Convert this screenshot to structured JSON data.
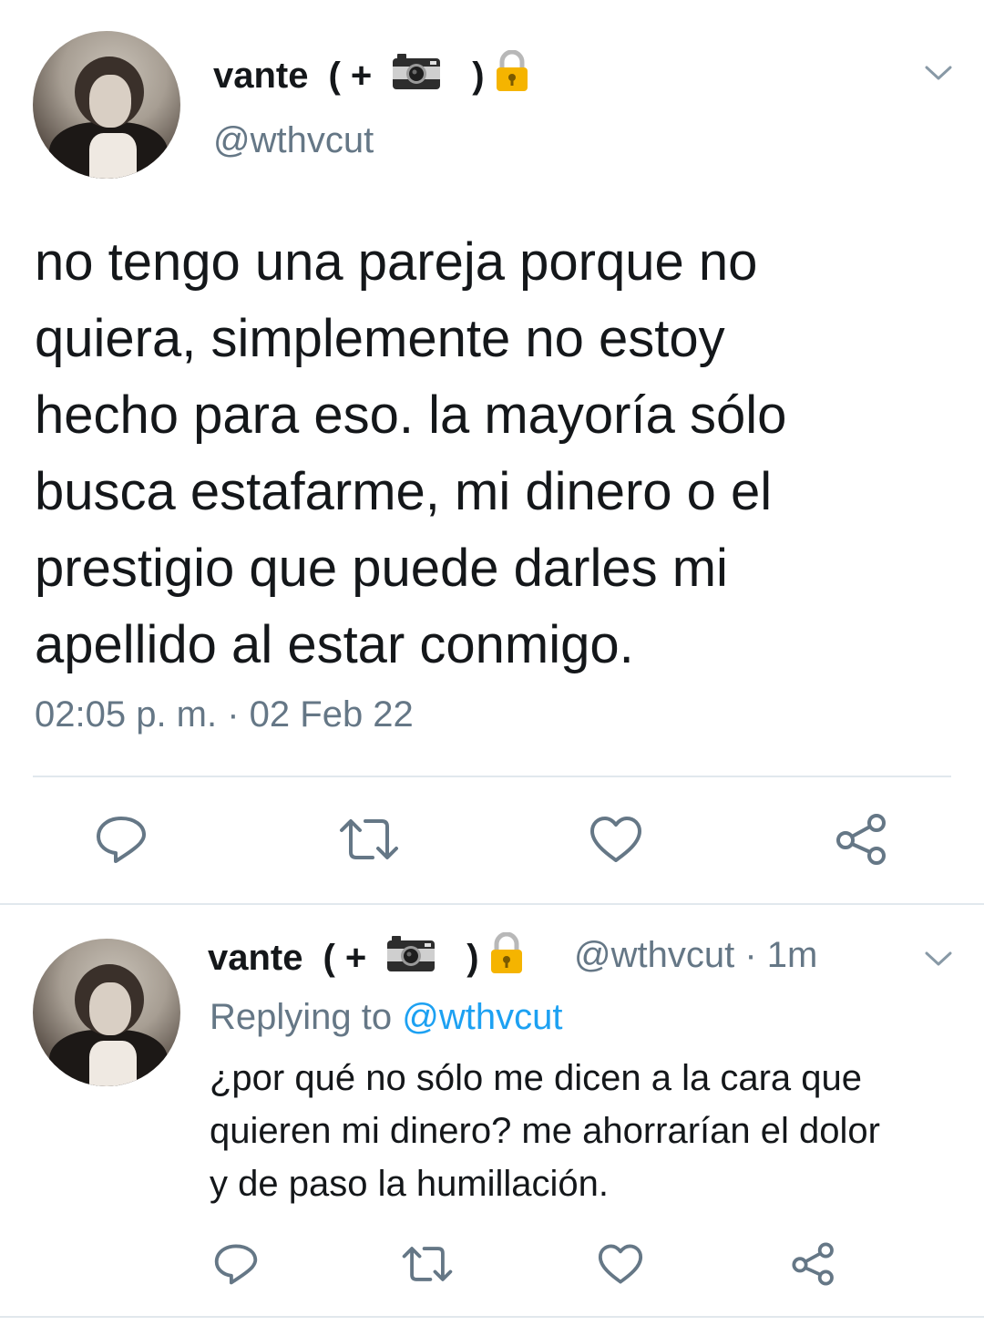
{
  "main_tweet": {
    "author": {
      "display_name_text": "vante",
      "display_name_open": "( +",
      "display_name_close": ")",
      "camera_icon": "camera-icon",
      "lock_icon": "lock-icon",
      "handle": "@wthvcut"
    },
    "text": "no tengo una pareja porque no\nquiera, simplemente no estoy\nhecho para eso. la mayoría sólo\nbusca estafarme, mi dinero o el\nprestigio que puede darles mi\napellido al estar conmigo.",
    "timestamp": "02:05 p. m. · 02 Feb 22",
    "actions": [
      "reply-icon",
      "retweet-icon",
      "like-icon",
      "share-icon"
    ]
  },
  "reply_tweet": {
    "author": {
      "display_name_text": "vante",
      "display_name_open": "( +",
      "display_name_close": ")",
      "handle": "@wthvcut",
      "time": "1m",
      "separator": "·"
    },
    "replying_to_label": "Replying to",
    "replying_to_handle": "@wthvcut",
    "text": "¿por qué no sólo me dicen a la cara que\nquieren mi dinero? me ahorrarían el dolor\ny de paso la humillación.",
    "actions": [
      "reply-icon",
      "retweet-icon",
      "like-icon",
      "share-icon"
    ]
  },
  "colors": {
    "text": "#14171a",
    "secondary": "#657786",
    "link": "#1da1f2",
    "icon": "#657786",
    "divider": "#e1e8ed",
    "lock": "#f5b400"
  }
}
